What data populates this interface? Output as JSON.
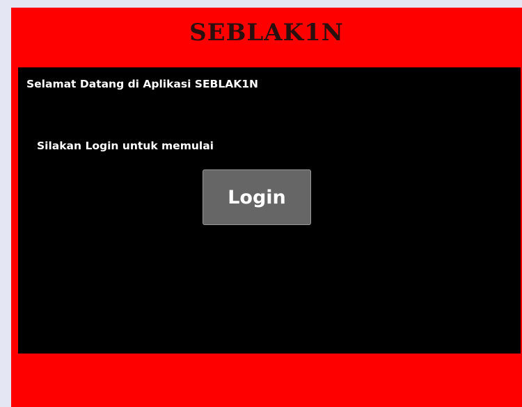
{
  "app": {
    "title": "SEBLAK1N"
  },
  "main": {
    "welcome_text": "Selamat Datang di Aplikasi SEBLAK1N",
    "prompt_text": "Silakan Login untuk memulai",
    "login_label": "Login"
  },
  "colors": {
    "frame_background": "#ff0000",
    "panel_background": "#000000",
    "button_background": "#666666",
    "title_color": "#2a0f0f",
    "text_color": "#ffffff"
  }
}
